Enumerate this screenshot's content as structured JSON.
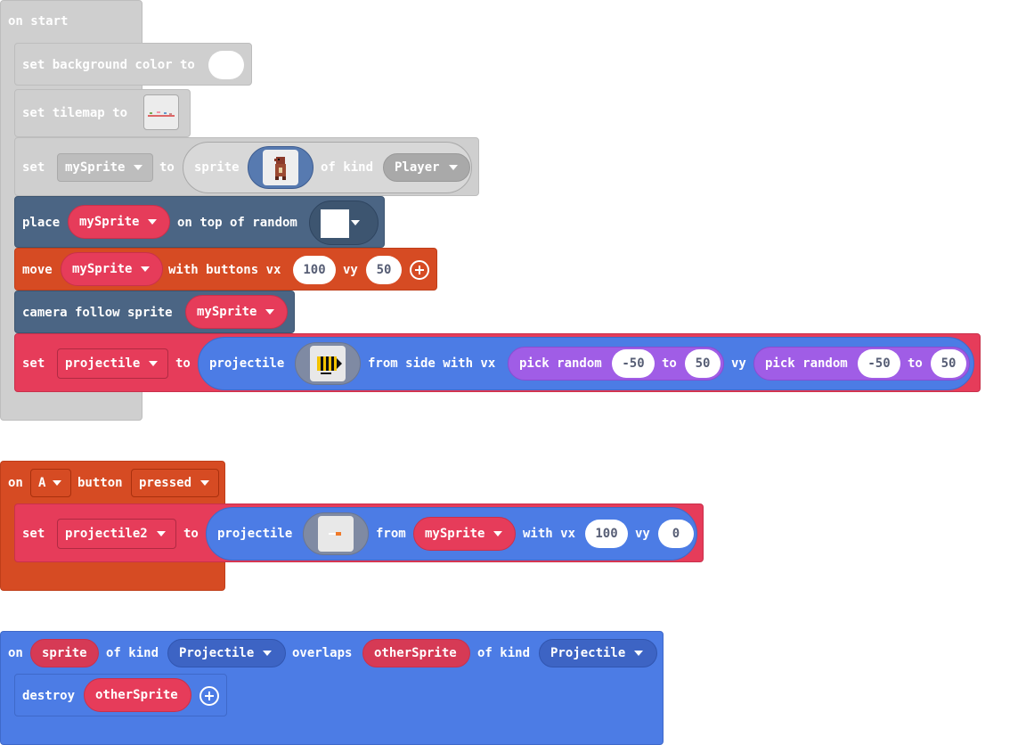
{
  "on_start": {
    "hat": "on start",
    "bg_label": "set background color to",
    "tilemap_label": "set tilemap to",
    "set_label": "set",
    "to_label": "to",
    "var_mysprite": "mySprite",
    "sprite_label": "sprite",
    "of_kind_label": "of kind",
    "kind_player": "Player",
    "place_label": "place",
    "on_top_label": "on top of random",
    "move_label": "move",
    "with_buttons_label": "with buttons vx",
    "vx_value": "100",
    "vy_label": "vy",
    "vy_value": "50",
    "camera_label": "camera follow sprite",
    "var_projectile": "projectile",
    "projectile_label": "projectile",
    "from_side_label": "from side with vx",
    "pick_random_label": "pick random",
    "rand_min": "-50",
    "rand_max": "50"
  },
  "a_button": {
    "on_label": "on",
    "button_key": "A",
    "button_label": "button",
    "event": "pressed",
    "set_label": "set",
    "var_projectile2": "projectile2",
    "to_label": "to",
    "projectile_label": "projectile",
    "from_label": "from",
    "var_mysprite": "mySprite",
    "with_vx_label": "with vx",
    "vx_value": "100",
    "vy_label": "vy",
    "vy_value": "0"
  },
  "overlap": {
    "on_label": "on",
    "sprite_var": "sprite",
    "of_kind_label": "of kind",
    "kind1": "Projectile",
    "overlaps_label": "overlaps",
    "other_var": "otherSprite",
    "kind2": "Projectile",
    "destroy_label": "destroy",
    "destroy_var": "otherSprite"
  },
  "colors": {
    "looks_grey": "#cfcfcf",
    "scene_slate": "#4b6584",
    "controller_orange": "#d64b23",
    "sprite_red": "#e63c5a",
    "sprites_blue": "#4c7ce5",
    "math_purple": "#a05de6"
  }
}
